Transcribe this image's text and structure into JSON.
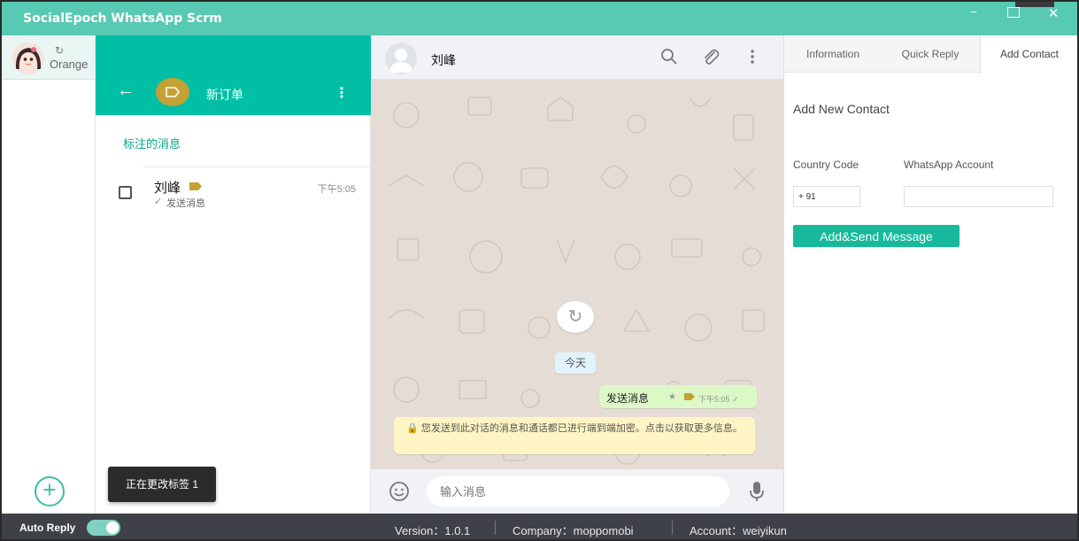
{
  "window": {
    "title": "SocialEpoch WhatsApp Scrm",
    "min": "−",
    "close": "✕"
  },
  "account": {
    "refresh_icon": "↻",
    "name": "Orange",
    "add_icon": "+"
  },
  "label_panel": {
    "back": "←",
    "title": "新订单",
    "menu": "⋮",
    "starred_title": "标注的消息",
    "chats": [
      {
        "name": "刘峰",
        "time": "下午5:05",
        "check": "✓",
        "preview": "发送消息"
      }
    ],
    "toast": "正在更改标签 1"
  },
  "chat": {
    "contact_name": "刘峰",
    "refresh_icon": "↻",
    "date": "今天",
    "message": {
      "text": "发送消息",
      "star": "★",
      "time": "下午5:05 ✓"
    },
    "encryption": "🔒 您发送到此对话的消息和通话都已进行端到端加密。点击以获取更多信息。",
    "input_placeholder": "输入消息"
  },
  "right_panel": {
    "tabs": [
      "Information",
      "Quick Reply",
      "Add Contact"
    ],
    "active_tab": "Add Contact",
    "title": "Add New Contact",
    "country_code_label": "Country Code",
    "whatsapp_label": "WhatsApp Account",
    "country_code_value": "+ 91",
    "whatsapp_value": "",
    "send_button": "Add&Send Message"
  },
  "status_bar": {
    "auto_reply": "Auto Reply",
    "auto_reply_on": true,
    "version": "Version：1.0.1",
    "company": "Company：moppomobi",
    "account": "Account：weiyikun"
  },
  "colors": {
    "titlebar": "#58c9b3",
    "header_teal": "#00bfa5",
    "tag_gold": "#c4a133",
    "button_teal": "#17b99a",
    "statusbar": "#3f4148"
  }
}
